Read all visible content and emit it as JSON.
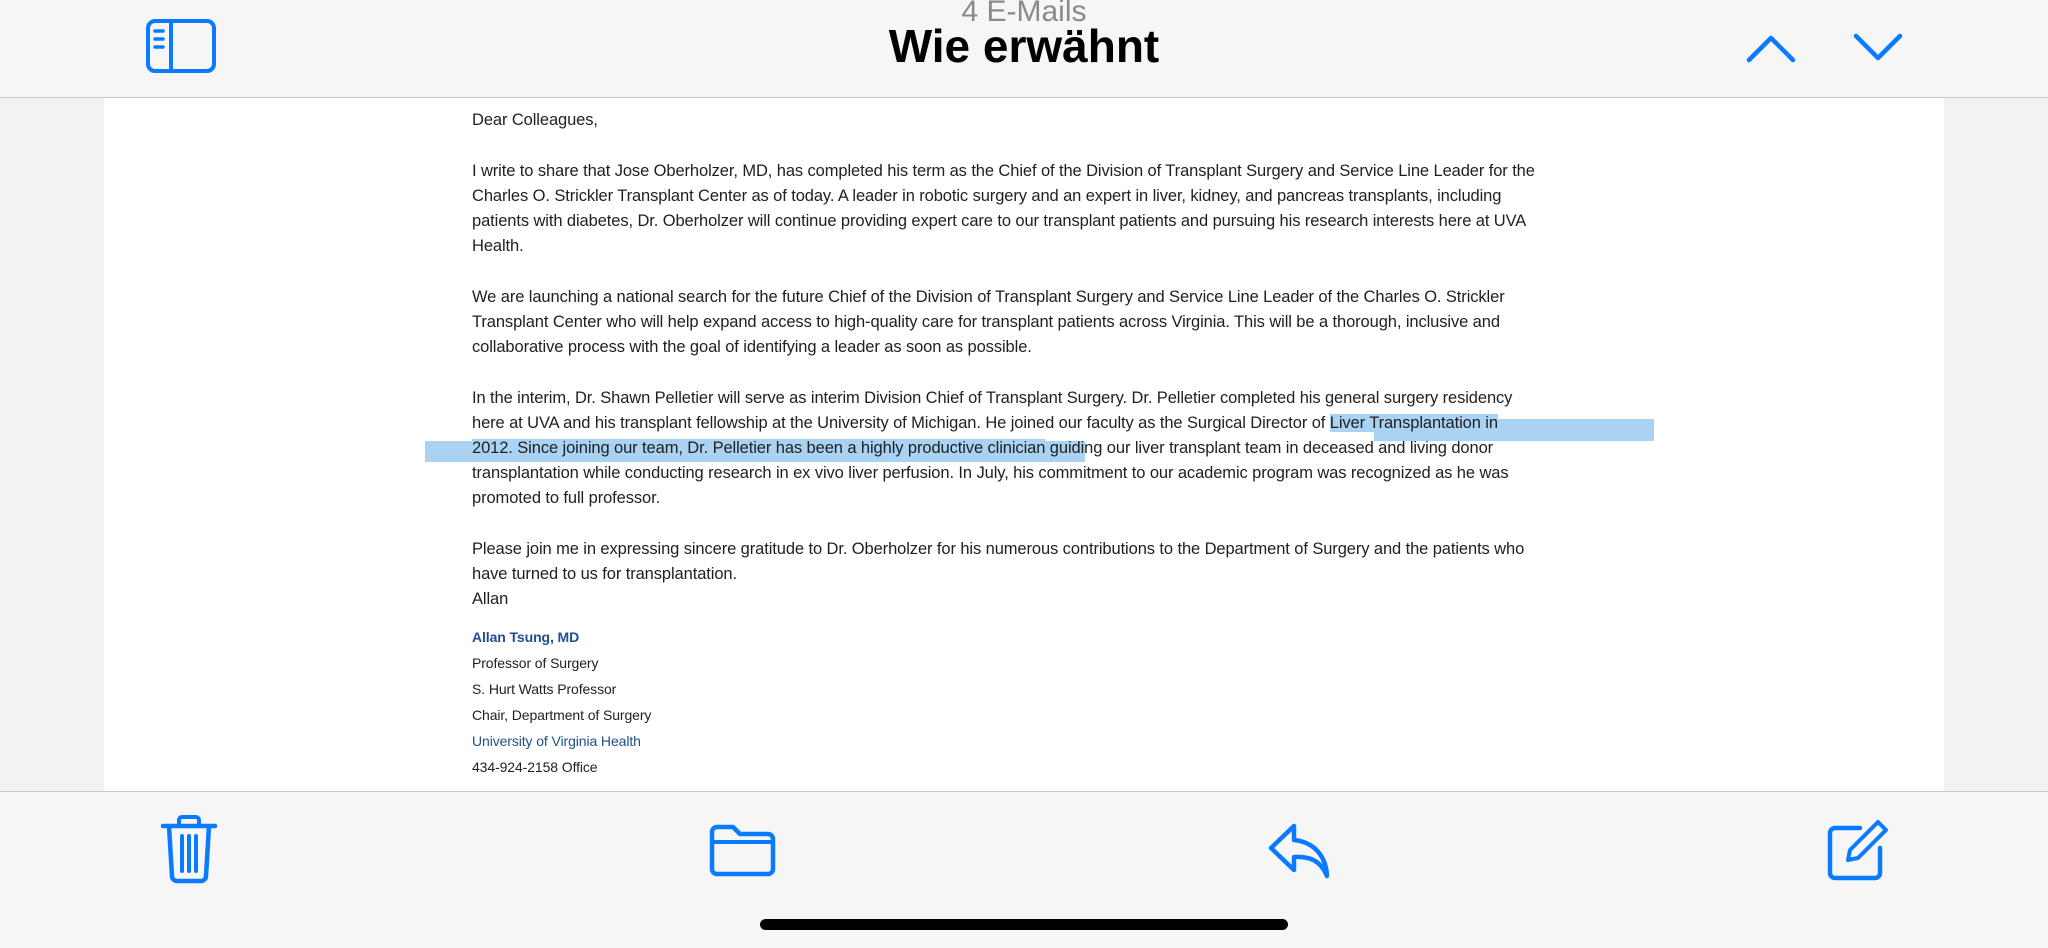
{
  "header": {
    "count_label": "4 E-Mails",
    "title": "Wie erwähnt",
    "sidebar_icon": "sidebar-toggle-icon",
    "prev_icon": "chevron-up-icon",
    "next_icon": "chevron-down-icon"
  },
  "letter": {
    "salutation": "Dear Colleagues,",
    "p1": [
      "I write to share that Jose Oberholzer, MD, has completed his term as the Chief of the Division of Transplant Surgery and Service Line Leader for the",
      "Charles O. Strickler Transplant Center as of today. A leader in robotic surgery and an expert in liver, kidney, and pancreas transplants, including",
      "patients with diabetes, Dr. Oberholzer will continue providing expert care to our transplant patients and pursuing his research interests here at UVA",
      "Health."
    ],
    "p2": [
      "We are launching a national search for the future Chief of the Division of Transplant Surgery and Service Line Leader of the Charles O. Strickler",
      "Transplant Center who will help expand access to high-quality care for transplant patients across Virginia. This will be a thorough, inclusive and",
      "collaborative process with the goal of identifying a leader as soon as possible."
    ],
    "p3": {
      "l1": "In the interim, Dr. Shawn Pelletier will serve as interim Division Chief of Transplant Surgery.  Dr. Pelletier completed his general surgery residency",
      "l2_pre": "here at UVA and his transplant fellowship at the University of Michigan.  He joined our faculty as the Surgical Director of ",
      "l2_hl": "Liver Transplantation in",
      "l3_hl": "2012.  Since joining our team, Dr. Pelletier has been a highly productive clinician",
      "l3_post": " guiding our liver transplant team in deceased and living donor",
      "l4": "transplantation while conducting research in ex vivo liver perfusion.  In July, his commitment to our academic program was recognized as he was",
      "l5": "promoted to full professor."
    },
    "p4": [
      "Please join me in expressing sincere gratitude to Dr. Oberholzer for his numerous contributions to the Department of Surgery and the patients who",
      "have turned to us for transplantation."
    ],
    "closing": "Allan",
    "signature": {
      "name": "Allan Tsung, MD",
      "line1": "Professor of Surgery",
      "line2": "S. Hurt Watts Professor",
      "line3": "Chair, Department of Surgery",
      "org": "University of Virginia Health",
      "phone": "434-924-2158 Office"
    }
  },
  "toolbar": {
    "trash_icon": "trash-icon",
    "folder_icon": "folder-icon",
    "reply_icon": "reply-icon",
    "compose_icon": "compose-icon"
  },
  "colors": {
    "accent": "#0a7aff",
    "highlight": "#a9d2f3",
    "signature_blue": "#1f4f8c"
  }
}
